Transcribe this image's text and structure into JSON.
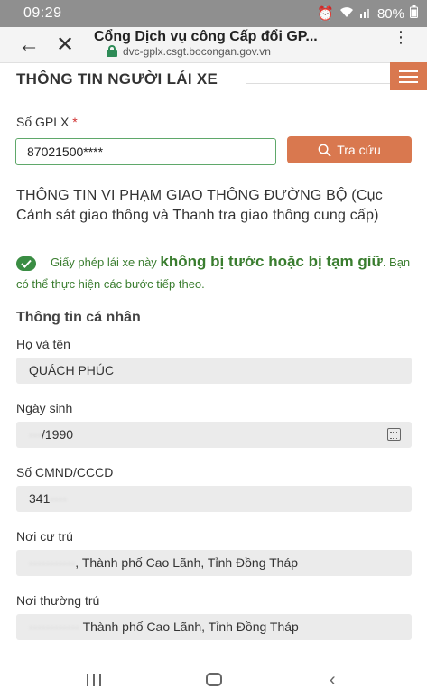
{
  "status_bar": {
    "time": "09:29",
    "battery": "80%",
    "icons": [
      "alarm-icon",
      "wifi-icon",
      "signal-icon",
      "battery-icon"
    ]
  },
  "browser": {
    "title": "Cổng Dịch vụ công Cấp đổi GP...",
    "url": "dvc-gplx.csgt.bocongan.gov.vn",
    "back_glyph": "←",
    "close_glyph": "✕",
    "menu_glyph": "⋮"
  },
  "section": {
    "heading": "THÔNG TIN NGƯỜI LÁI XE"
  },
  "lookup": {
    "label": "Số GPLX",
    "required_mark": "*",
    "value": "87021500****",
    "button_label": "Tra cứu"
  },
  "violation": {
    "title": "THÔNG TIN VI PHẠM GIAO THÔNG ĐƯỜNG BỘ (Cục Cảnh sát giao thông và Thanh tra giao thông cung cấp)",
    "result_prefix": "Giấy phép lái xe này",
    "result_highlight": "không bị tước hoặc bị tạm giữ",
    "result_suffix": ". Bạn có thể thực hiện các bước tiếp theo."
  },
  "personal": {
    "heading": "Thông tin cá nhân",
    "fields": [
      {
        "label": "Họ và tên",
        "hidden": "",
        "value": "QUÁCH PHÚC"
      },
      {
        "label": "Ngày sinh",
        "hidden": "···",
        "value": "/1990"
      },
      {
        "label": "Số CMND/CCCD",
        "hidden": "",
        "value": "341"
      },
      {
        "label": "Nơi cư trú",
        "hidden": "···········",
        "value": ", Thành phố Cao Lãnh, Tỉnh Đồng Tháp"
      },
      {
        "label": "Nơi thường trú",
        "hidden": "············",
        "value": " Thành phố Cao Lãnh, Tỉnh Đồng Tháp"
      }
    ]
  },
  "colors": {
    "accent": "#d9784f",
    "success": "#3a7d2f",
    "input_border": "#5fa86a",
    "field_bg": "#ebebeb"
  }
}
